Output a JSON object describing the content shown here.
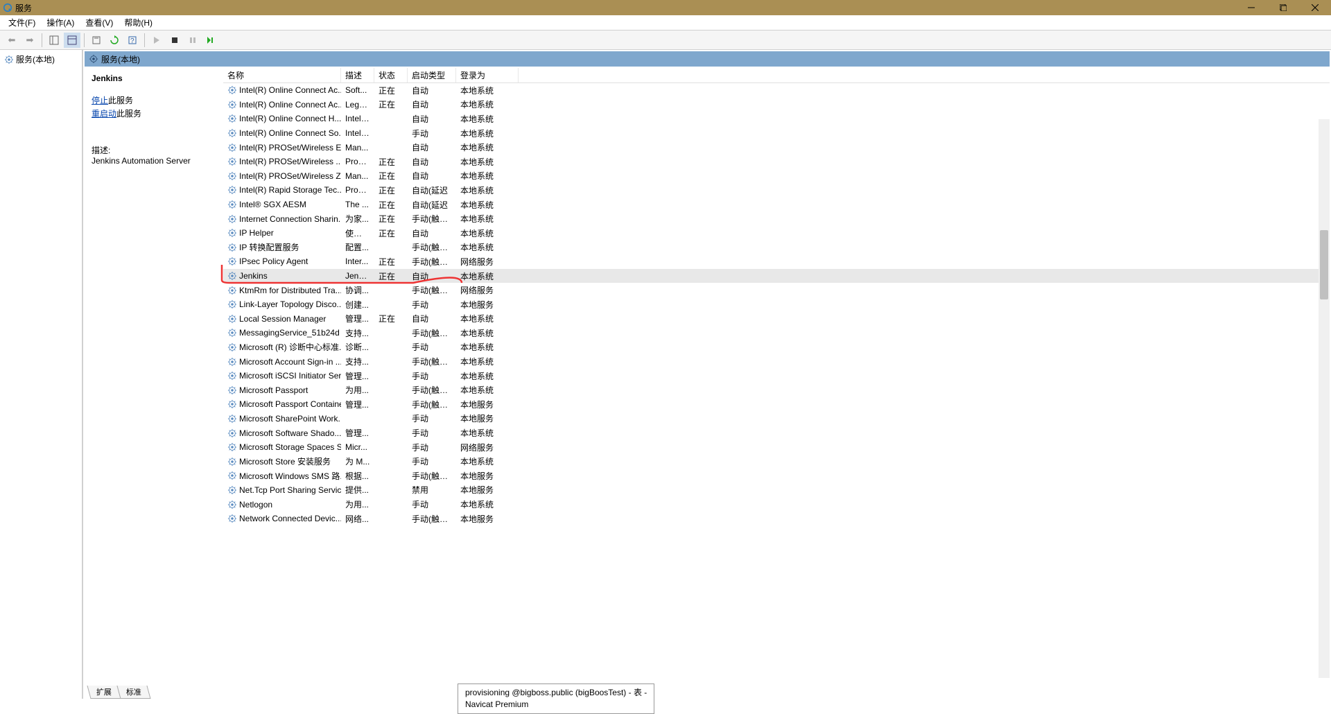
{
  "window": {
    "title": "服务"
  },
  "menu": {
    "file": "文件(F)",
    "action": "操作(A)",
    "view": "查看(V)",
    "help": "帮助(H)"
  },
  "tree": {
    "root": "服务(本地)"
  },
  "right_header": "服务(本地)",
  "detail": {
    "name": "Jenkins",
    "stop_link": "停止",
    "stop_suffix": "此服务",
    "restart_link": "重启动",
    "restart_suffix": "此服务",
    "desc_label": "描述:",
    "desc_text": "Jenkins Automation Server"
  },
  "columns": {
    "name": "名称",
    "desc": "描述",
    "status": "状态",
    "startup": "启动类型",
    "logon": "登录为"
  },
  "services": [
    {
      "name": "Intel(R) Online Connect Ac...",
      "desc": "Soft...",
      "status": "正在",
      "startup": "自动",
      "logon": "本地系统"
    },
    {
      "name": "Intel(R) Online Connect Ac...",
      "desc": "Lega...",
      "status": "正在",
      "startup": "自动",
      "logon": "本地系统"
    },
    {
      "name": "Intel(R) Online Connect H...",
      "desc": "Intel(...",
      "status": "",
      "startup": "自动",
      "logon": "本地系统"
    },
    {
      "name": "Intel(R) Online Connect So...",
      "desc": "Intel(...",
      "status": "",
      "startup": "手动",
      "logon": "本地系统"
    },
    {
      "name": "Intel(R) PROSet/Wireless E...",
      "desc": "Man...",
      "status": "",
      "startup": "自动",
      "logon": "本地系统"
    },
    {
      "name": "Intel(R) PROSet/Wireless ...",
      "desc": "Provi...",
      "status": "正在",
      "startup": "自动",
      "logon": "本地系统"
    },
    {
      "name": "Intel(R) PROSet/Wireless Z...",
      "desc": "Man...",
      "status": "正在",
      "startup": "自动",
      "logon": "本地系统"
    },
    {
      "name": "Intel(R) Rapid Storage Tec...",
      "desc": "Provi...",
      "status": "正在",
      "startup": "自动(延迟",
      "logon": "本地系统"
    },
    {
      "name": "Intel® SGX AESM",
      "desc": "The ...",
      "status": "正在",
      "startup": "自动(延迟",
      "logon": "本地系统"
    },
    {
      "name": "Internet Connection Sharin...",
      "desc": "为家...",
      "status": "正在",
      "startup": "手动(触发...",
      "logon": "本地系统"
    },
    {
      "name": "IP Helper",
      "desc": "使用 ...",
      "status": "正在",
      "startup": "自动",
      "logon": "本地系统"
    },
    {
      "name": "IP 转换配置服务",
      "desc": "配置...",
      "status": "",
      "startup": "手动(触发...",
      "logon": "本地系统"
    },
    {
      "name": "IPsec Policy Agent",
      "desc": "Inter...",
      "status": "正在",
      "startup": "手动(触发...",
      "logon": "网络服务"
    },
    {
      "name": "Jenkins",
      "desc": "Jenki...",
      "status": "正在",
      "startup": "自动",
      "logon": "本地系统",
      "selected": true
    },
    {
      "name": "KtmRm for Distributed Tra...",
      "desc": "协调...",
      "status": "",
      "startup": "手动(触发...",
      "logon": "网络服务"
    },
    {
      "name": "Link-Layer Topology Disco...",
      "desc": "创建...",
      "status": "",
      "startup": "手动",
      "logon": "本地服务"
    },
    {
      "name": "Local Session Manager",
      "desc": "管理...",
      "status": "正在",
      "startup": "自动",
      "logon": "本地系统"
    },
    {
      "name": "MessagingService_51b24d",
      "desc": "支持...",
      "status": "",
      "startup": "手动(触发...",
      "logon": "本地系统"
    },
    {
      "name": "Microsoft (R) 诊断中心标准...",
      "desc": "诊断...",
      "status": "",
      "startup": "手动",
      "logon": "本地系统"
    },
    {
      "name": "Microsoft Account Sign-in ...",
      "desc": "支持...",
      "status": "",
      "startup": "手动(触发...",
      "logon": "本地系统"
    },
    {
      "name": "Microsoft iSCSI Initiator Ser...",
      "desc": "管理...",
      "status": "",
      "startup": "手动",
      "logon": "本地系统"
    },
    {
      "name": "Microsoft Passport",
      "desc": "为用...",
      "status": "",
      "startup": "手动(触发...",
      "logon": "本地系统"
    },
    {
      "name": "Microsoft Passport Container",
      "desc": "管理...",
      "status": "",
      "startup": "手动(触发...",
      "logon": "本地服务"
    },
    {
      "name": "Microsoft SharePoint Work...",
      "desc": "",
      "status": "",
      "startup": "手动",
      "logon": "本地服务"
    },
    {
      "name": "Microsoft Software Shado...",
      "desc": "管理...",
      "status": "",
      "startup": "手动",
      "logon": "本地系统"
    },
    {
      "name": "Microsoft Storage Spaces S",
      "desc": "Micr...",
      "status": "",
      "startup": "手动",
      "logon": "网络服务"
    },
    {
      "name": "Microsoft Store 安装服务",
      "desc": "为 M...",
      "status": "",
      "startup": "手动",
      "logon": "本地系统"
    },
    {
      "name": "Microsoft Windows SMS 路...",
      "desc": "根据...",
      "status": "",
      "startup": "手动(触发...",
      "logon": "本地服务"
    },
    {
      "name": "Net.Tcp Port Sharing Service",
      "desc": "提供...",
      "status": "",
      "startup": "禁用",
      "logon": "本地服务"
    },
    {
      "name": "Netlogon",
      "desc": "为用...",
      "status": "",
      "startup": "手动",
      "logon": "本地系统"
    },
    {
      "name": "Network Connected Devic...",
      "desc": "网络...",
      "status": "",
      "startup": "手动(触发...",
      "logon": "本地服务"
    }
  ],
  "tabs": {
    "extended": "扩展",
    "standard": "标准"
  },
  "tooltip": {
    "line1": "provisioning @bigboss.public (bigBoosTest) - 表 -",
    "line2": "Navicat Premium"
  }
}
